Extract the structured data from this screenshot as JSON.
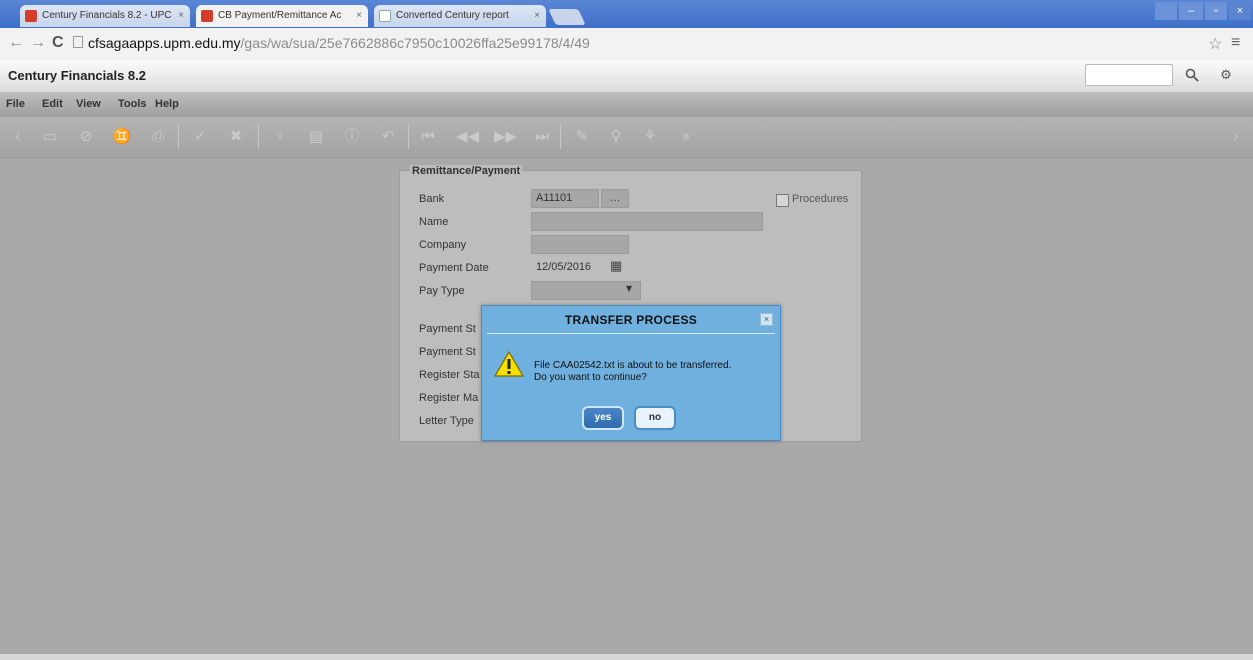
{
  "browser": {
    "tabs": [
      {
        "label": "Century Financials 8.2 - UPC",
        "active": false,
        "icon": "app-favicon"
      },
      {
        "label": "CB Payment/Remittance Ac",
        "active": true,
        "icon": "app-favicon"
      },
      {
        "label": "Converted Century report",
        "active": false,
        "icon": "document-favicon"
      }
    ],
    "tab_close": "×",
    "url_host": "cfsagaapps.upm.edu.my",
    "url_path": "/gas/wa/sua/25e7662886c7950c10026ffa25e99178/4/49"
  },
  "app": {
    "title": "Century Financials 8.2",
    "search_placeholder": "",
    "menu": [
      "File",
      "Edit",
      "View",
      "Tools",
      "Help"
    ]
  },
  "form": {
    "section_title": "Remittance/Payment",
    "fields": {
      "bank": {
        "label": "Bank",
        "value": "A11101"
      },
      "name": {
        "label": "Name",
        "value": ""
      },
      "company": {
        "label": "Company",
        "value": ""
      },
      "payment_date": {
        "label": "Payment Date",
        "value": "12/05/2016"
      },
      "pay_type": {
        "label": "Pay Type",
        "value": ""
      },
      "payment_st1": {
        "label": "Payment St"
      },
      "payment_st2": {
        "label": "Payment St"
      },
      "register_sta": {
        "label": "Register Sta"
      },
      "register_ma": {
        "label": "Register Ma"
      },
      "letter_type": {
        "label": "Letter Type"
      }
    },
    "procedures_label": "Procedures"
  },
  "dialog": {
    "title": "TRANSFER PROCESS",
    "message_line1": "File CAA02542.txt is about to be transferred.",
    "message_line2": "Do you want to continue?",
    "yes_label": "yes",
    "no_label": "no",
    "close_label": "×"
  },
  "icons": {
    "back": "←",
    "forward": "→",
    "reload": "C",
    "star": "☆",
    "menu": "≡",
    "search": "🔍",
    "settings": "⚙",
    "calendar": "▦",
    "dropdown": "▾",
    "lookup": "…"
  },
  "colors": {
    "dialog_bg": "#6fb0df",
    "dialog_border": "#4a8cc3",
    "warning_yellow": "#f4e000",
    "page_bg": "#a9a9a9"
  }
}
